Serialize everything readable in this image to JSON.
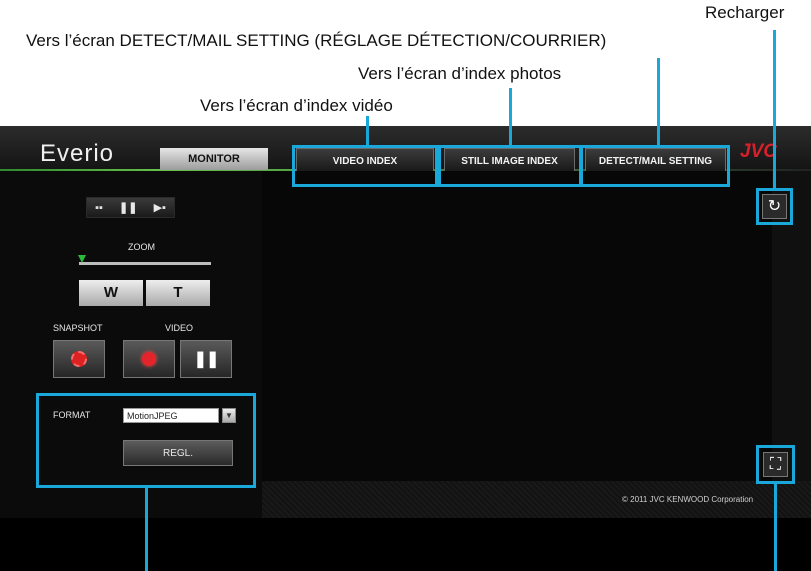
{
  "annotations": {
    "reload": "Recharger",
    "detect_mail": "Vers l’écran DETECT/MAIL SETTING (RÉGLAGE DÉTECTION/COURRIER)",
    "photo_index": "Vers l’écran d’index photos",
    "video_index": "Vers l’écran d’index vidéo"
  },
  "app": {
    "logo": "Everio",
    "brand": "JVC",
    "tab_monitor": "MONITOR",
    "nav": {
      "video_index": "VIDEO INDEX",
      "still_index": "STILL IMAGE INDEX",
      "detect_mail": "DETECT/MAIL SETTING"
    },
    "controls": {
      "mode_icons": "▪▪  ❚❚  ▶▪",
      "zoom_label": "ZOOM",
      "zoom_level": 0.0,
      "zoom_wide": "W",
      "zoom_tele": "T",
      "snapshot_label": "SNAPSHOT",
      "video_label": "VIDEO",
      "pause_glyph": "❚❚"
    },
    "format": {
      "label": "FORMAT",
      "selected": "MotionJPEG",
      "apply": "REGL."
    },
    "footer": "© 2011 JVC KENWOOD Corporation",
    "icons": {
      "reload": "↻",
      "fullscreen": "⛶"
    }
  },
  "colors": {
    "callout": "#1aa7d9",
    "brand_red": "#d8202a",
    "zoom_knob": "#2bbb3b"
  }
}
